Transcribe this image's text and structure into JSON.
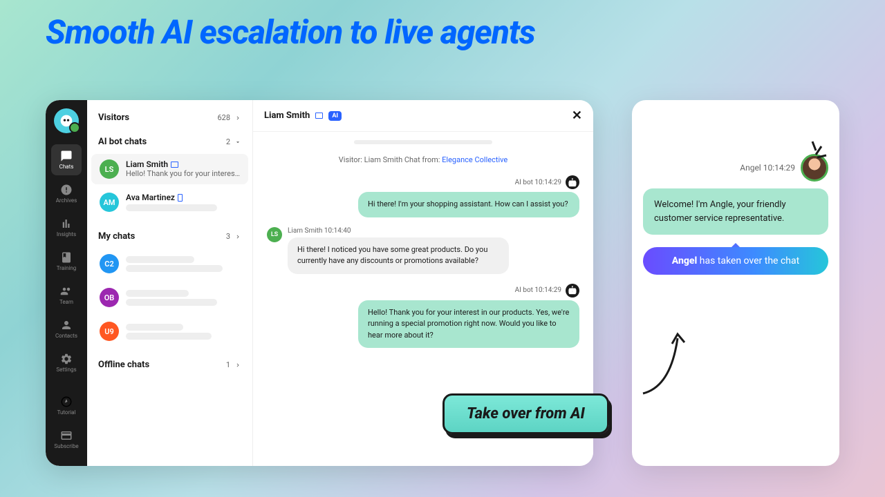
{
  "headline": "Smooth AI escalation to live agents",
  "nav": {
    "items": [
      {
        "label": "Chats",
        "active": true
      },
      {
        "label": "Archives"
      },
      {
        "label": "Insights"
      },
      {
        "label": "Training"
      },
      {
        "label": "Team"
      },
      {
        "label": "Contacts"
      },
      {
        "label": "Settings"
      }
    ],
    "bottom": [
      {
        "label": "Tutorial"
      },
      {
        "label": "Subscribe"
      }
    ]
  },
  "list": {
    "visitors": {
      "title": "Visitors",
      "count": "628"
    },
    "ai_chats": {
      "title": "AI bot chats",
      "count": "2"
    },
    "items": [
      {
        "initials": "LS",
        "name": "Liam Smith",
        "preview": "Hello! Thank you for your interest...",
        "color": "green"
      },
      {
        "initials": "AM",
        "name": "Ava Martinez",
        "preview": "",
        "color": "teal"
      }
    ],
    "my_chats": {
      "title": "My chats",
      "count": "3"
    },
    "my_items": [
      {
        "initials": "C2",
        "color": "blue"
      },
      {
        "initials": "OB",
        "color": "purple"
      },
      {
        "initials": "U9",
        "color": "orange"
      }
    ],
    "offline": {
      "title": "Offline chats",
      "count": "1"
    }
  },
  "conversation": {
    "name": "Liam Smith",
    "ai_badge": "AI",
    "info_prefix": "Visitor: Liam Smith Chat from: ",
    "info_link": "Elegance Collective",
    "messages": [
      {
        "sender": "bot",
        "meta": "AI bot 10:14:29",
        "text": "Hi there! I'm your shopping assistant. How can I assist you?"
      },
      {
        "sender": "visitor",
        "meta": "Liam Smith 10:14:40",
        "initials": "LS",
        "text": "Hi there! I noticed you have some great products. Do you currently have any discounts or promotions available?"
      },
      {
        "sender": "bot",
        "meta": "AI bot 10:14:29",
        "text": "Hello! Thank you for your interest in our products. Yes, we're running a special promotion right now. Would you like to hear more about it?"
      }
    ]
  },
  "agent": {
    "name": "Angel",
    "time": "10:14:29",
    "greeting": "Welcome! I'm Angle, your friendly customer service representative.",
    "banner_name": "Angel",
    "banner_rest": " has taken over the chat"
  },
  "callout": "Take over from AI"
}
